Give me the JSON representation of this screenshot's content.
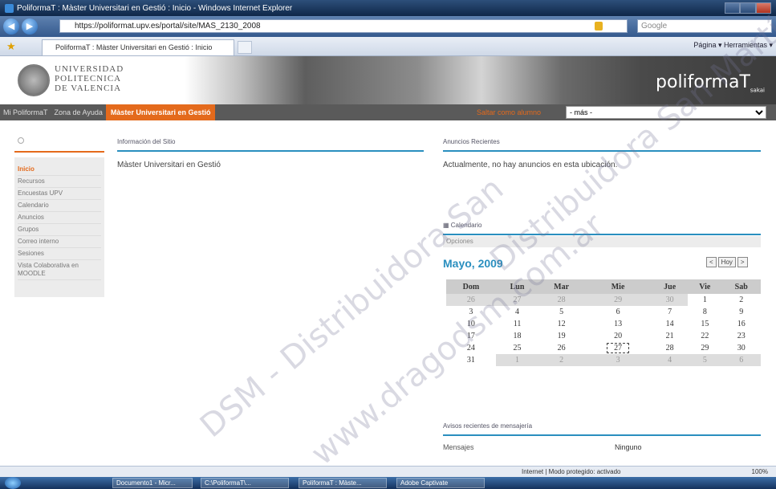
{
  "window": {
    "title": "PoliformaT : Màster Universitari en Gestió : Inicio - Windows Internet Explorer"
  },
  "addressbar": {
    "url": "https://poliformat.upv.es/portal/site/MAS_2130_2008",
    "search_placeholder": "Google"
  },
  "tabbar": {
    "tab_label": "PoliformaT : Màster Universitari en Gestió : Inicio",
    "tools": "Página ▾  Herramientas ▾"
  },
  "banner": {
    "university": [
      "UNIVERSIDAD",
      "POLITECNICA",
      "DE VALENCIA"
    ],
    "brand": "poliformaT",
    "brand_sub": "sakai"
  },
  "nav": {
    "items": [
      "Mi PoliformaT",
      "Zona de Ayuda"
    ],
    "active": "Màster Universitari en Gestió",
    "switch_label": "Saltar como alumno",
    "select_value": "- más -"
  },
  "menu": {
    "items": [
      {
        "label": "Inicio",
        "current": true
      },
      {
        "label": "Recursos",
        "current": false
      },
      {
        "label": "Encuestas UPV",
        "current": false
      },
      {
        "label": "Calendario",
        "current": false
      },
      {
        "label": "Anuncios",
        "current": false
      },
      {
        "label": "Grupos",
        "current": false
      },
      {
        "label": "Correo interno",
        "current": false
      },
      {
        "label": "Sesiones",
        "current": false
      },
      {
        "label": "Vista Colaborativa en MOODLE",
        "current": false
      }
    ]
  },
  "site_info": {
    "header": "Información del Sitio",
    "body": "Màster Universitari en Gestió"
  },
  "announcements": {
    "header": "Anuncios Recientes",
    "body": "Actualmente, no hay anuncios en esta ubicación."
  },
  "calendar": {
    "header": "Calendario",
    "options": "Opciones",
    "month": "Mayo, 2009",
    "nav": [
      "<",
      "Hoy",
      ">"
    ],
    "days": [
      "Dom",
      "Lun",
      "Mar",
      "Mie",
      "Jue",
      "Vie",
      "Sab"
    ],
    "weeks": [
      [
        {
          "d": "26",
          "o": true
        },
        {
          "d": "27",
          "o": true
        },
        {
          "d": "28",
          "o": true
        },
        {
          "d": "29",
          "o": true
        },
        {
          "d": "30",
          "o": true
        },
        {
          "d": "1"
        },
        {
          "d": "2"
        }
      ],
      [
        {
          "d": "3"
        },
        {
          "d": "4"
        },
        {
          "d": "5"
        },
        {
          "d": "6"
        },
        {
          "d": "7"
        },
        {
          "d": "8"
        },
        {
          "d": "9"
        }
      ],
      [
        {
          "d": "10"
        },
        {
          "d": "11"
        },
        {
          "d": "12"
        },
        {
          "d": "13"
        },
        {
          "d": "14"
        },
        {
          "d": "15"
        },
        {
          "d": "16"
        }
      ],
      [
        {
          "d": "17"
        },
        {
          "d": "18"
        },
        {
          "d": "19"
        },
        {
          "d": "20"
        },
        {
          "d": "21"
        },
        {
          "d": "22"
        },
        {
          "d": "23"
        }
      ],
      [
        {
          "d": "24"
        },
        {
          "d": "25"
        },
        {
          "d": "26"
        },
        {
          "d": "27",
          "t": true
        },
        {
          "d": "28"
        },
        {
          "d": "29"
        },
        {
          "d": "30"
        }
      ],
      [
        {
          "d": "31"
        },
        {
          "d": "1",
          "o": true
        },
        {
          "d": "2",
          "o": true
        },
        {
          "d": "3",
          "o": true
        },
        {
          "d": "4",
          "o": true
        },
        {
          "d": "5",
          "o": true
        },
        {
          "d": "6",
          "o": true
        }
      ]
    ]
  },
  "messages": {
    "header": "Avisos recientes de mensajería",
    "label": "Mensajes",
    "value": "Ninguno"
  },
  "status": {
    "zone": "Internet | Modo protegido: activado",
    "zoom": "100%"
  },
  "taskbar": {
    "tasks": [
      "Documento1 - Micr...",
      "C:\\PoliformaT\\...",
      "PoliformaT : Màste...",
      "Adobe Captivate"
    ]
  },
  "watermarks": [
    "Distribuidora San Martín",
    "DSM - Distribuidora San",
    "www.dragodsm.com.ar"
  ]
}
